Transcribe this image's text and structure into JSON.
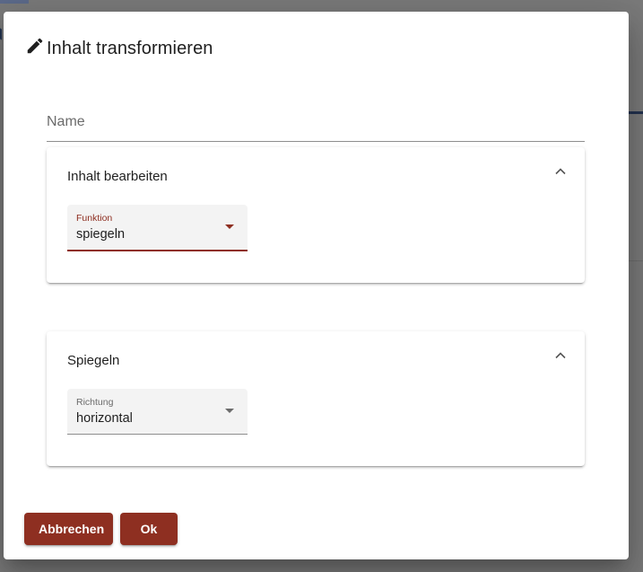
{
  "dialog": {
    "title": "Inhalt transformieren",
    "title_icon": "pencil-icon"
  },
  "name_field": {
    "placeholder": "Name",
    "value": ""
  },
  "panels": [
    {
      "title": "Inhalt bearbeiten",
      "expanded": true,
      "field": {
        "label": "Funktion",
        "value": "spiegeln",
        "focused": true
      }
    },
    {
      "title": "Spiegeln",
      "expanded": true,
      "field": {
        "label": "Richtung",
        "value": "horizontal",
        "focused": false
      }
    }
  ],
  "actions": {
    "cancel_label": "Abbrechen",
    "ok_label": "Ok"
  },
  "colors": {
    "accent": "#8e2f21",
    "field_background": "#f3f3f3",
    "backdrop": "#7a7a7a"
  }
}
